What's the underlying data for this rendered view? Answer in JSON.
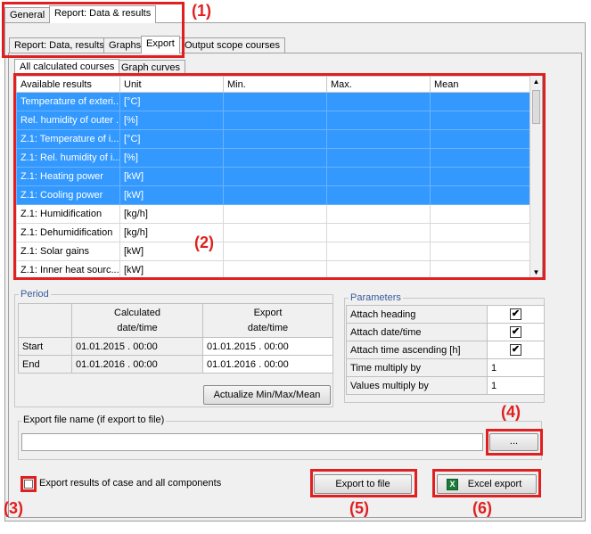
{
  "tabs_top": [
    "General",
    "Report: Data & results"
  ],
  "tabs_second": [
    "Report: Data, results",
    "Graphs",
    "Export",
    "Output scope courses"
  ],
  "tabs_third": [
    "All calculated courses",
    "Graph curves"
  ],
  "results_table": {
    "headers": [
      "Available results",
      "Unit",
      "Min.",
      "Max.",
      "Mean"
    ],
    "rows": [
      {
        "name": "Temperature of exteri...",
        "unit": "[°C]",
        "selected": true
      },
      {
        "name": "Rel. humidity of outer ...",
        "unit": "[%]",
        "selected": true
      },
      {
        "name": "Z.1: Temperature of i...",
        "unit": "[°C]",
        "selected": true
      },
      {
        "name": "Z.1: Rel. humidity of i...",
        "unit": "[%]",
        "selected": true
      },
      {
        "name": "Z.1: Heating power",
        "unit": "[kW]",
        "selected": true
      },
      {
        "name": "Z.1: Cooling power",
        "unit": "[kW]",
        "selected": true
      },
      {
        "name": "Z.1: Humidification",
        "unit": "[kg/h]",
        "selected": false
      },
      {
        "name": "Z.1: Dehumidification",
        "unit": "[kg/h]",
        "selected": false
      },
      {
        "name": "Z.1: Solar gains",
        "unit": "[kW]",
        "selected": false
      },
      {
        "name": "Z.1: Inner heat sourc...",
        "unit": "[kW]",
        "selected": false
      }
    ]
  },
  "period": {
    "legend": "Period",
    "col1_line1": "Calculated",
    "col1_line2": "date/time",
    "col2_line1": "Export",
    "col2_line2": "date/time",
    "start_label": "Start",
    "end_label": "End",
    "start_calc": "01.01.2015 . 00:00",
    "start_export": "01.01.2015 . 00:00",
    "end_calc": "01.01.2016 . 00:00",
    "end_export": "01.01.2016 . 00:00",
    "actualize_label": "Actualize Min/Max/Mean"
  },
  "parameters": {
    "legend": "Parameters",
    "attach_heading": "Attach heading",
    "attach_datetime": "Attach date/time",
    "attach_time_ascending": "Attach time ascending [h]",
    "time_multiply": "Time multiply by",
    "time_multiply_value": "1",
    "values_multiply": "Values multiply by",
    "values_multiply_value": "1",
    "check_mark": "✔"
  },
  "export_file": {
    "label": "Export file name (if export to file)",
    "value": "",
    "browse_label": "..."
  },
  "export_all_label": "Export results of case and all components",
  "export_to_file_label": "Export to file",
  "excel_export_label": "Excel export",
  "callouts": [
    "(1)",
    "(2)",
    "(3)",
    "(4)",
    "(5)",
    "(6)"
  ],
  "colors": {
    "selection": "#3399ff",
    "annotation": "#e02020",
    "legend_text": "#3a5a9a"
  }
}
